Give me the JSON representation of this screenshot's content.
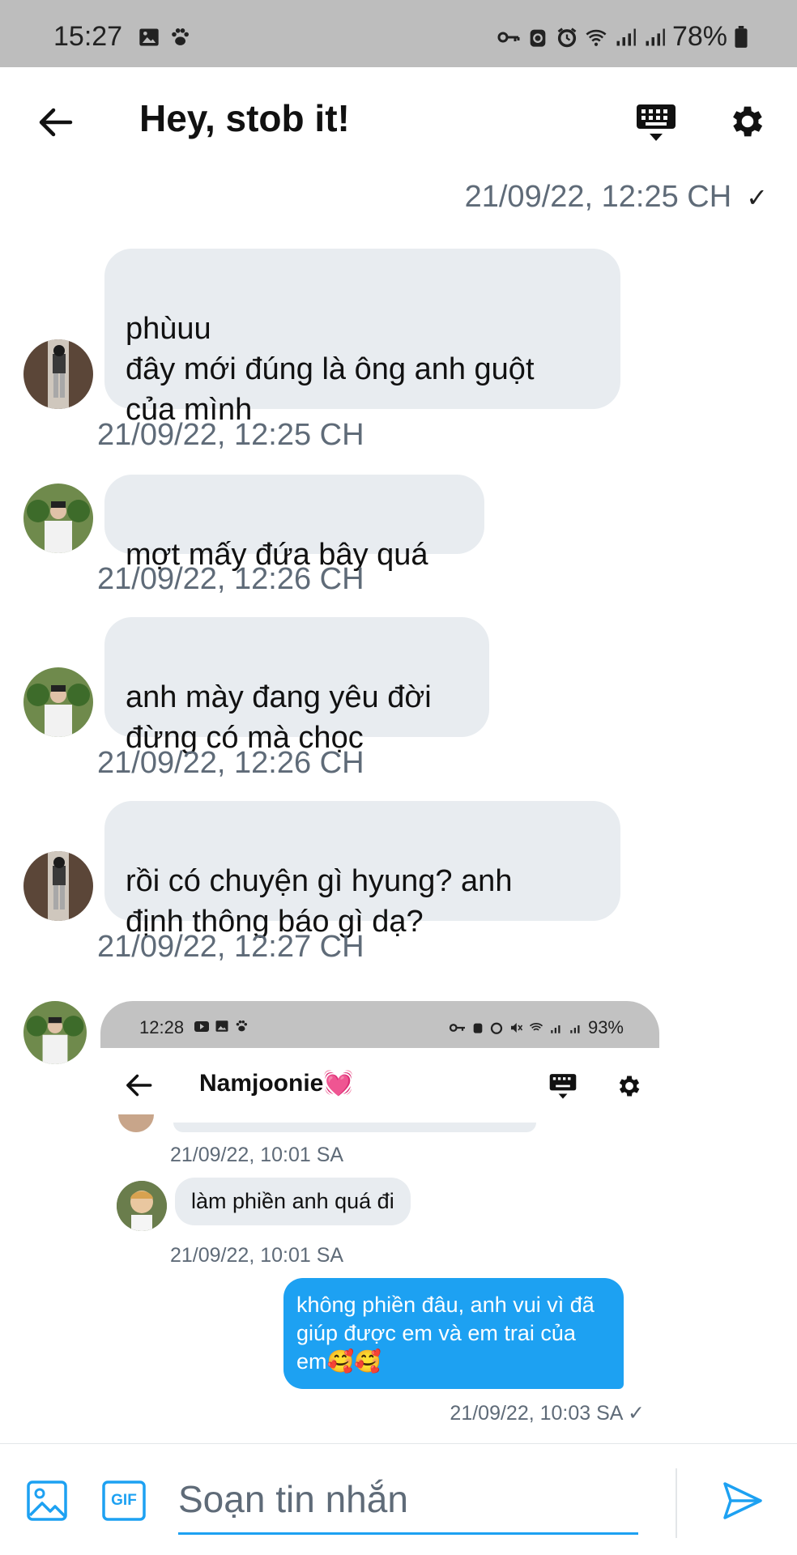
{
  "status_bar": {
    "time": "15:27",
    "battery": "78%"
  },
  "header": {
    "title": "Hey, stob it!"
  },
  "top_timestamp": "21/09/22, 12:25 CH",
  "top_check": "✓",
  "messages": [
    {
      "text": "phùuu\nđây mới đúng là ông anh guột\ncủa mình",
      "timestamp": "21/09/22, 12:25 CH"
    },
    {
      "text": "mợt mấy đứa bây quá",
      "timestamp": "21/09/22, 12:26 CH"
    },
    {
      "text": "anh mày đang yêu đời\nđừng có mà chọc",
      "timestamp": "21/09/22, 12:26 CH"
    },
    {
      "text": "rồi có chuyện gì hyung? anh\nđịnh thông báo gì dạ?",
      "timestamp": "21/09/22, 12:27 CH"
    }
  ],
  "embedded": {
    "status_time": "12:28",
    "status_battery": "93%",
    "title": "Namjoonie💓",
    "ts1": "21/09/22, 10:01 SA",
    "bubble": "làm phiền anh quá đi",
    "ts2": "21/09/22, 10:01 SA",
    "own_message": "không phiền đâu, anh vui vì đã giúp được em và em trai của em🥰🥰",
    "ts3": "21/09/22, 10:03 SA ✓"
  },
  "composer": {
    "placeholder": "Soạn tin nhắn",
    "gif_label": "GIF"
  },
  "colors": {
    "accent": "#1da1f2",
    "bubble": "#e8ecf0",
    "timestamp": "#5f6b78"
  }
}
